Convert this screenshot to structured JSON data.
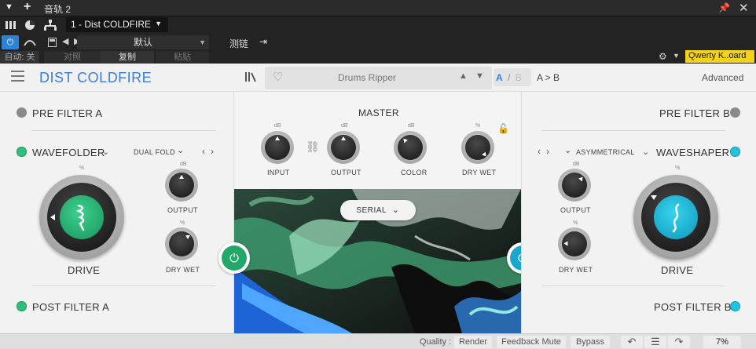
{
  "host": {
    "window_title": "音轨 2",
    "plugin_name": "1 - Dist COLDFIRE",
    "preset_name": "默认",
    "auto_label": "自动: 关",
    "compare_label": "对照",
    "copy_label": "复制",
    "paste_label": "粘贴",
    "sidechain_label": "测链",
    "keyboard_label": "Qwerty K..oard"
  },
  "plugin": {
    "brand": "DIST COLDFIRE",
    "preset": "Drums Ripper",
    "ab_a": "A",
    "ab_sep": "/",
    "ab_b": "B",
    "a_to_b": "A > B",
    "advanced": "Advanced"
  },
  "left": {
    "pre_filter": "PRE FILTER A",
    "module": "WAVEFOLDER",
    "mode": "DUAL FOLD",
    "drive_unit": "%",
    "drive_label": "DRIVE",
    "output_unit": "dB",
    "output_label": "OUTPUT",
    "drywet_unit": "%",
    "drywet_label": "DRY WET",
    "post_filter": "POST FILTER A",
    "accent": "#23a86a"
  },
  "right": {
    "pre_filter": "PRE FILTER B",
    "module": "WAVESHAPER",
    "mode": "ASYMMETRICAL",
    "drive_unit": "%",
    "drive_label": "DRIVE",
    "output_unit": "dB",
    "output_label": "OUTPUT",
    "drywet_unit": "%",
    "drywet_label": "DRY WET",
    "post_filter": "POST FILTER B",
    "accent": "#1aa7cd"
  },
  "master": {
    "title": "MASTER",
    "input_unit": "dB",
    "input_label": "INPUT",
    "output_unit": "dB",
    "output_label": "OUTPUT",
    "color_unit": "dB",
    "color_label": "COLOR",
    "drywet_unit": "%",
    "drywet_label": "DRY WET",
    "routing": "SERIAL"
  },
  "footer": {
    "quality_label": "Quality :",
    "render": "Render",
    "feedback_mute": "Feedback Mute",
    "bypass": "Bypass",
    "cpu": "7%"
  },
  "icons": [
    "menu-icon",
    "library-icon",
    "heart-icon",
    "lock-icon",
    "link-icon",
    "power-icon",
    "undo-icon",
    "redo-icon",
    "list-icon",
    "gear-icon",
    "pin-icon",
    "close-icon"
  ]
}
